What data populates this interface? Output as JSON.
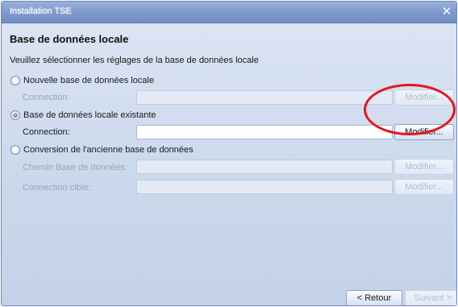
{
  "window": {
    "title": "Installation TSE",
    "close_icon": "close-icon"
  },
  "section": {
    "title": "Base de données locale",
    "subtitle": "Veuillez sélectionner les réglages de la base de données locale"
  },
  "options": [
    {
      "label": "Nouvelle base de données locale",
      "checked": false,
      "fields": [
        {
          "label": "Connection:",
          "value": "",
          "enabled": false,
          "button": "Modifier..."
        }
      ]
    },
    {
      "label": "Base de données locale existante",
      "checked": true,
      "fields": [
        {
          "label": "Connection:",
          "value": "",
          "enabled": true,
          "button": "Modifier..."
        }
      ]
    },
    {
      "label": "Conversion de l'ancienne base de données",
      "checked": false,
      "fields": [
        {
          "label": "Chemin Base de données:",
          "value": "",
          "enabled": false,
          "button": "Modifier..."
        },
        {
          "label": "Connection cible:",
          "value": "",
          "enabled": false,
          "button": "Modifier..."
        }
      ]
    }
  ],
  "footer": {
    "back_label": "< Retour",
    "next_label": "Suivant >",
    "next_enabled": false
  },
  "colors": {
    "highlight": "#e8141c",
    "titlebar": "#7f9acd",
    "background": "#ccd9ec"
  }
}
